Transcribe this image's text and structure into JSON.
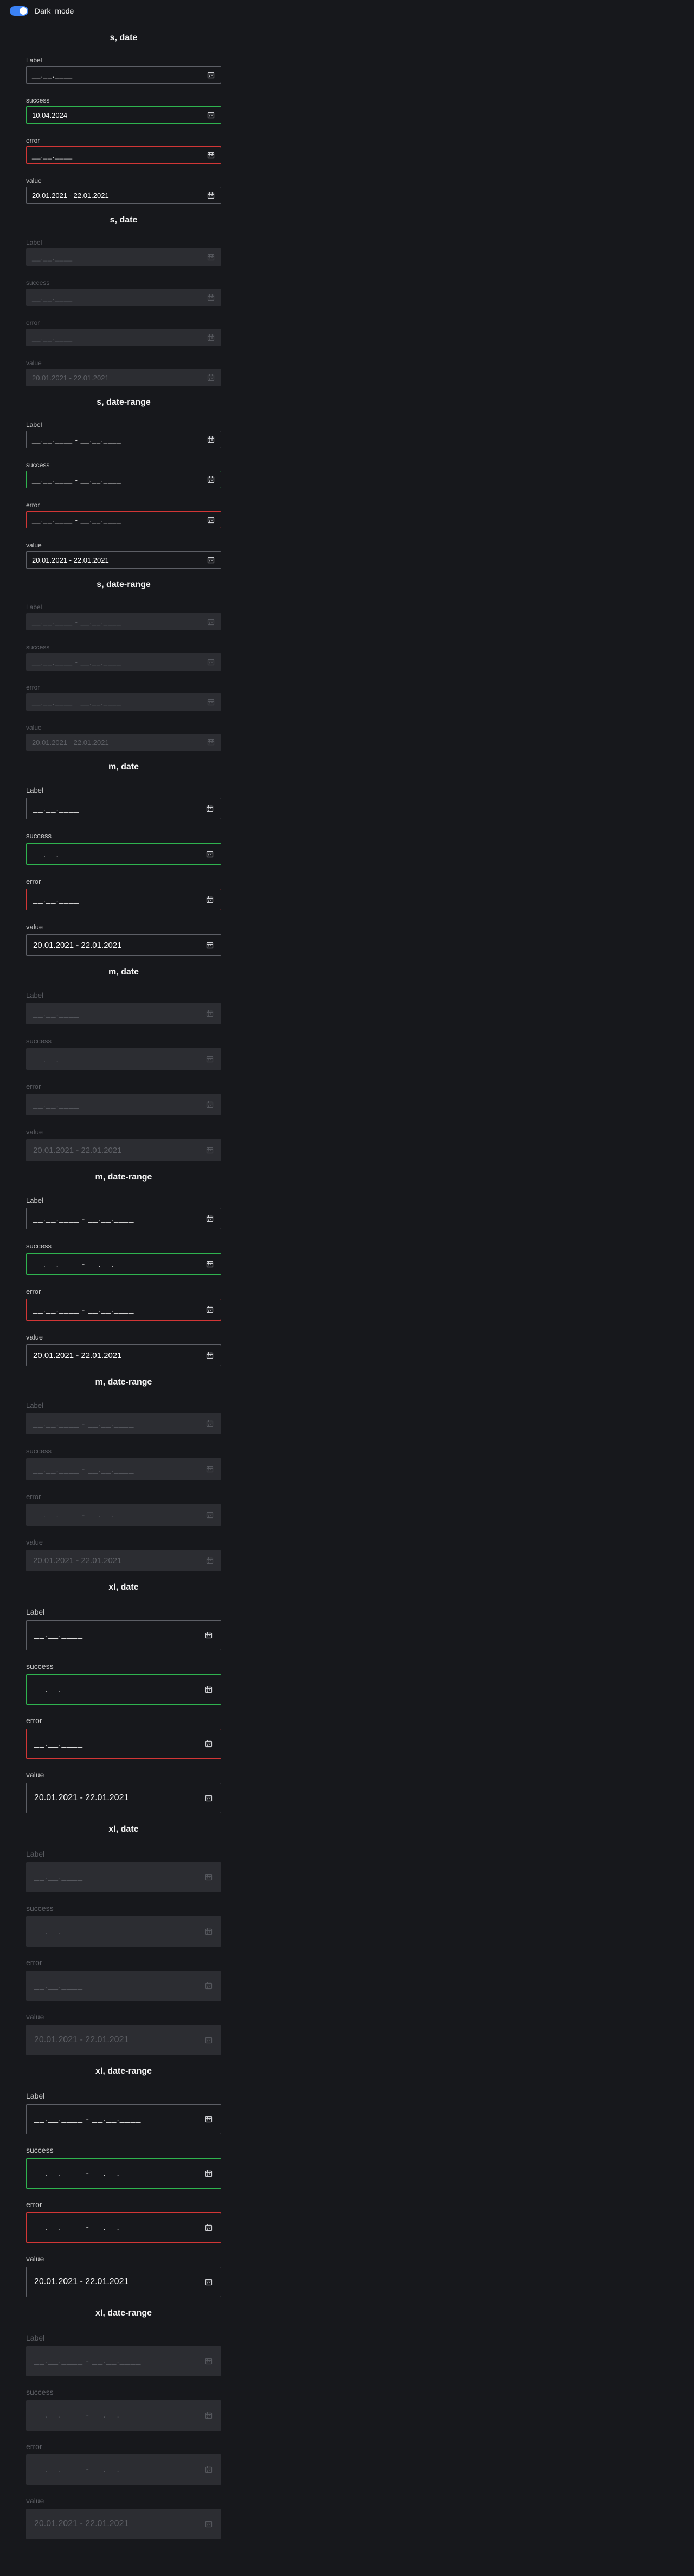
{
  "topbar": {
    "toggle_label": "Dark_mode",
    "toggle_on": true
  },
  "colors": {
    "accent": "#3b82f6",
    "success": "#2fb34f",
    "error": "#d23636",
    "background": "#17181c"
  },
  "icons": {
    "field_icon": "calendar-icon"
  },
  "sections": [
    {
      "title": "s, date",
      "size": "s",
      "type": "date",
      "disabled": false,
      "fields": [
        {
          "label": "Label",
          "state": "default",
          "value": "",
          "placeholder": "__.__.____"
        },
        {
          "label": "success",
          "state": "success",
          "value": "10.04.2024",
          "placeholder": ""
        },
        {
          "label": "error",
          "state": "error",
          "value": "",
          "placeholder": "__.__.____"
        },
        {
          "label": "value",
          "state": "default",
          "value": "20.01.2021 - 22.01.2021",
          "placeholder": ""
        }
      ]
    },
    {
      "title": "s, date",
      "size": "s",
      "type": "date",
      "disabled": true,
      "fields": [
        {
          "label": "Label",
          "state": "default",
          "value": "",
          "placeholder": "__.__.____"
        },
        {
          "label": "success",
          "state": "success",
          "value": "",
          "placeholder": "__.__.____"
        },
        {
          "label": "error",
          "state": "error",
          "value": "",
          "placeholder": "__.__.____"
        },
        {
          "label": "value",
          "state": "default",
          "value": "20.01.2021 - 22.01.2021",
          "placeholder": ""
        }
      ]
    },
    {
      "title": "s, date-range",
      "size": "s",
      "type": "date-range",
      "disabled": false,
      "fields": [
        {
          "label": "Label",
          "state": "default",
          "value": "",
          "placeholder": "__.__.____ - __.__.____"
        },
        {
          "label": "success",
          "state": "success",
          "value": "",
          "placeholder": "__.__.____ - __.__.____"
        },
        {
          "label": "error",
          "state": "error",
          "value": "",
          "placeholder": "__.__.____ - __.__.____"
        },
        {
          "label": "value",
          "state": "default",
          "value": "20.01.2021 - 22.01.2021",
          "placeholder": ""
        }
      ]
    },
    {
      "title": "s, date-range",
      "size": "s",
      "type": "date-range",
      "disabled": true,
      "fields": [
        {
          "label": "Label",
          "state": "default",
          "value": "",
          "placeholder": "__.__.____ - __.__.____"
        },
        {
          "label": "success",
          "state": "success",
          "value": "",
          "placeholder": "__.__.____ - __.__.____"
        },
        {
          "label": "error",
          "state": "error",
          "value": "",
          "placeholder": "__.__.____ - __.__.____"
        },
        {
          "label": "value",
          "state": "default",
          "value": "20.01.2021 - 22.01.2021",
          "placeholder": ""
        }
      ]
    },
    {
      "title": "m, date",
      "size": "m",
      "type": "date",
      "disabled": false,
      "fields": [
        {
          "label": "Label",
          "state": "default",
          "value": "",
          "placeholder": "__.__.____"
        },
        {
          "label": "success",
          "state": "success",
          "value": "",
          "placeholder": "__.__.____"
        },
        {
          "label": "error",
          "state": "error",
          "value": "",
          "placeholder": "__.__.____"
        },
        {
          "label": "value",
          "state": "default",
          "value": "20.01.2021 - 22.01.2021",
          "placeholder": ""
        }
      ]
    },
    {
      "title": "m, date",
      "size": "m",
      "type": "date",
      "disabled": true,
      "fields": [
        {
          "label": "Label",
          "state": "default",
          "value": "",
          "placeholder": "__.__.____"
        },
        {
          "label": "success",
          "state": "success",
          "value": "",
          "placeholder": "__.__.____"
        },
        {
          "label": "error",
          "state": "error",
          "value": "",
          "placeholder": "__.__.____"
        },
        {
          "label": "value",
          "state": "default",
          "value": "20.01.2021 - 22.01.2021",
          "placeholder": ""
        }
      ]
    },
    {
      "title": "m, date-range",
      "size": "m",
      "type": "date-range",
      "disabled": false,
      "fields": [
        {
          "label": "Label",
          "state": "default",
          "value": "",
          "placeholder": "__.__.____ - __.__.____"
        },
        {
          "label": "success",
          "state": "success",
          "value": "",
          "placeholder": "__.__.____ - __.__.____"
        },
        {
          "label": "error",
          "state": "error",
          "value": "",
          "placeholder": "__.__.____ - __.__.____"
        },
        {
          "label": "value",
          "state": "default",
          "value": "20.01.2021 - 22.01.2021",
          "placeholder": ""
        }
      ]
    },
    {
      "title": "m, date-range",
      "size": "m",
      "type": "date-range",
      "disabled": true,
      "fields": [
        {
          "label": "Label",
          "state": "default",
          "value": "",
          "placeholder": "__.__.____ - __.__.____"
        },
        {
          "label": "success",
          "state": "success",
          "value": "",
          "placeholder": "__.__.____ - __.__.____"
        },
        {
          "label": "error",
          "state": "error",
          "value": "",
          "placeholder": "__.__.____ - __.__.____"
        },
        {
          "label": "value",
          "state": "default",
          "value": "20.01.2021 - 22.01.2021",
          "placeholder": ""
        }
      ]
    },
    {
      "title": "xl, date",
      "size": "xl",
      "type": "date",
      "disabled": false,
      "fields": [
        {
          "label": "Label",
          "state": "default",
          "value": "",
          "placeholder": "__.__.____"
        },
        {
          "label": "success",
          "state": "success",
          "value": "",
          "placeholder": "__.__.____"
        },
        {
          "label": "error",
          "state": "error",
          "value": "",
          "placeholder": "__.__.____"
        },
        {
          "label": "value",
          "state": "default",
          "value": "20.01.2021 - 22.01.2021",
          "placeholder": ""
        }
      ]
    },
    {
      "title": "xl, date",
      "size": "xl",
      "type": "date",
      "disabled": true,
      "fields": [
        {
          "label": "Label",
          "state": "default",
          "value": "",
          "placeholder": "__.__.____"
        },
        {
          "label": "success",
          "state": "success",
          "value": "",
          "placeholder": "__.__.____"
        },
        {
          "label": "error",
          "state": "error",
          "value": "",
          "placeholder": "__.__.____"
        },
        {
          "label": "value",
          "state": "default",
          "value": "20.01.2021 - 22.01.2021",
          "placeholder": ""
        }
      ]
    },
    {
      "title": "xl, date-range",
      "size": "xl",
      "type": "date-range",
      "disabled": false,
      "fields": [
        {
          "label": "Label",
          "state": "default",
          "value": "",
          "placeholder": "__.__.____ - __.__.____"
        },
        {
          "label": "success",
          "state": "success",
          "value": "",
          "placeholder": "__.__.____ - __.__.____"
        },
        {
          "label": "error",
          "state": "error",
          "value": "",
          "placeholder": "__.__.____ - __.__.____"
        },
        {
          "label": "value",
          "state": "default",
          "value": "20.01.2021 - 22.01.2021",
          "placeholder": ""
        }
      ]
    },
    {
      "title": "xl, date-range",
      "size": "xl",
      "type": "date-range",
      "disabled": true,
      "fields": [
        {
          "label": "Label",
          "state": "default",
          "value": "",
          "placeholder": "__.__.____ - __.__.____"
        },
        {
          "label": "success",
          "state": "success",
          "value": "",
          "placeholder": "__.__.____ - __.__.____"
        },
        {
          "label": "error",
          "state": "error",
          "value": "",
          "placeholder": "__.__.____ - __.__.____"
        },
        {
          "label": "value",
          "state": "default",
          "value": "20.01.2021 - 22.01.2021",
          "placeholder": ""
        }
      ]
    }
  ]
}
